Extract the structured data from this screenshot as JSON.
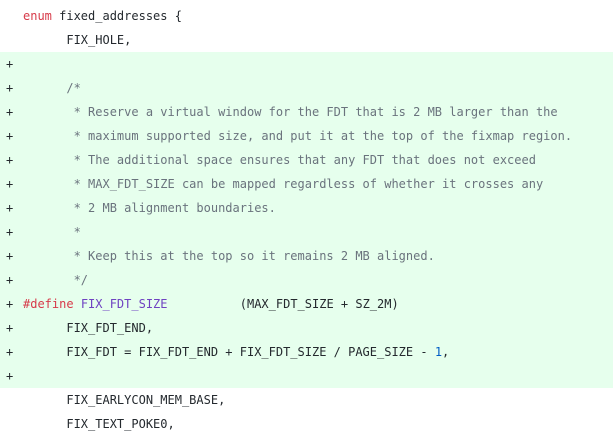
{
  "colors": {
    "added_background": "#e6ffed",
    "context_background": "#ffffff",
    "keyword": "#d73a49",
    "comment": "#6a737d",
    "macro": "#6f42c1",
    "number": "#005cc5",
    "text": "#24292e"
  },
  "diff": {
    "lines": [
      {
        "type": "context",
        "marker": "",
        "tokens": [
          {
            "style": "keyword",
            "text": "enum"
          },
          {
            "style": "plain",
            "text": " fixed_addresses {"
          }
        ]
      },
      {
        "type": "context",
        "marker": "",
        "tokens": [
          {
            "style": "plain",
            "text": "      FIX_HOLE,"
          }
        ]
      },
      {
        "type": "added",
        "marker": "+",
        "tokens": []
      },
      {
        "type": "added",
        "marker": "+",
        "tokens": [
          {
            "style": "comment",
            "text": "      /*"
          }
        ]
      },
      {
        "type": "added",
        "marker": "+",
        "tokens": [
          {
            "style": "comment",
            "text": "       * Reserve a virtual window for the FDT that is 2 MB larger than the"
          }
        ]
      },
      {
        "type": "added",
        "marker": "+",
        "tokens": [
          {
            "style": "comment",
            "text": "       * maximum supported size, and put it at the top of the fixmap region."
          }
        ]
      },
      {
        "type": "added",
        "marker": "+",
        "tokens": [
          {
            "style": "comment",
            "text": "       * The additional space ensures that any FDT that does not exceed"
          }
        ]
      },
      {
        "type": "added",
        "marker": "+",
        "tokens": [
          {
            "style": "comment",
            "text": "       * MAX_FDT_SIZE can be mapped regardless of whether it crosses any"
          }
        ]
      },
      {
        "type": "added",
        "marker": "+",
        "tokens": [
          {
            "style": "comment",
            "text": "       * 2 MB alignment boundaries."
          }
        ]
      },
      {
        "type": "added",
        "marker": "+",
        "tokens": [
          {
            "style": "comment",
            "text": "       *"
          }
        ]
      },
      {
        "type": "added",
        "marker": "+",
        "tokens": [
          {
            "style": "comment",
            "text": "       * Keep this at the top so it remains 2 MB aligned."
          }
        ]
      },
      {
        "type": "added",
        "marker": "+",
        "tokens": [
          {
            "style": "comment",
            "text": "       */"
          }
        ]
      },
      {
        "type": "added",
        "marker": "+",
        "tokens": [
          {
            "style": "keyword",
            "text": "#define"
          },
          {
            "style": "plain",
            "text": " "
          },
          {
            "style": "macro",
            "text": "FIX_FDT_SIZE"
          },
          {
            "style": "plain",
            "text": "          (MAX_FDT_SIZE + SZ_2M)"
          }
        ]
      },
      {
        "type": "added",
        "marker": "+",
        "tokens": [
          {
            "style": "plain",
            "text": "      FIX_FDT_END,"
          }
        ]
      },
      {
        "type": "added",
        "marker": "+",
        "tokens": [
          {
            "style": "plain",
            "text": "      FIX_FDT = FIX_FDT_END + FIX_FDT_SIZE / PAGE_SIZE - "
          },
          {
            "style": "number",
            "text": "1"
          },
          {
            "style": "plain",
            "text": ","
          }
        ]
      },
      {
        "type": "added",
        "marker": "+",
        "tokens": []
      },
      {
        "type": "context",
        "marker": "",
        "tokens": [
          {
            "style": "plain",
            "text": "      FIX_EARLYCON_MEM_BASE,"
          }
        ]
      },
      {
        "type": "context",
        "marker": "",
        "tokens": [
          {
            "style": "plain",
            "text": "      FIX_TEXT_POKE0,"
          }
        ]
      }
    ]
  }
}
